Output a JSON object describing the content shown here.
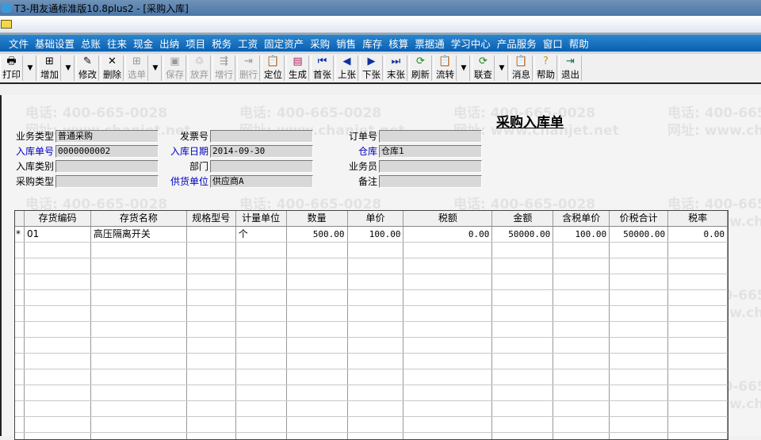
{
  "window": {
    "title": "T3-用友通标准版10.8plus2 - [采购入库]"
  },
  "watermark": {
    "phone": "电话: 400-665-0028",
    "site": "网址: www.chanjet.net"
  },
  "menu": [
    "文件",
    "基础设置",
    "总账",
    "往来",
    "现金",
    "出纳",
    "项目",
    "税务",
    "工资",
    "固定资产",
    "采购",
    "销售",
    "库存",
    "核算",
    "票据通",
    "学习中心",
    "产品服务",
    "窗口",
    "帮助"
  ],
  "toolbar": {
    "print": "打印",
    "add": "增加",
    "edit": "修改",
    "delete": "删除",
    "select": "选单",
    "save": "保存",
    "discard": "放弃",
    "add_row": "增行",
    "del_row": "删行",
    "locate": "定位",
    "generate": "生成",
    "first": "首张",
    "prev": "上张",
    "next": "下张",
    "last": "末张",
    "refresh": "刷新",
    "flow": "流转",
    "query": "联查",
    "message": "消息",
    "help": "帮助",
    "exit": "退出"
  },
  "form": {
    "title": "采购入库单",
    "business_type": {
      "label": "业务类型",
      "value": "普通采购"
    },
    "invoice_no": {
      "label": "发票号",
      "value": ""
    },
    "order_no": {
      "label": "订单号",
      "value": ""
    },
    "receipt_no": {
      "label": "入库单号",
      "value": "0000000002"
    },
    "receipt_date": {
      "label": "入库日期",
      "value": "2014-09-30"
    },
    "warehouse": {
      "label": "仓库",
      "value": "仓库1"
    },
    "receipt_category": {
      "label": "入库类别",
      "value": ""
    },
    "department": {
      "label": "部门",
      "value": ""
    },
    "salesperson": {
      "label": "业务员",
      "value": ""
    },
    "purchase_type": {
      "label": "采购类型",
      "value": ""
    },
    "supplier": {
      "label": "供货单位",
      "value": "供应商A"
    },
    "remark": {
      "label": "备注",
      "value": ""
    }
  },
  "table": {
    "columns": [
      "存货编码",
      "存货名称",
      "规格型号",
      "计量单位",
      "数量",
      "单价",
      "税额",
      "金额",
      "含税单价",
      "价税合计",
      "税率"
    ],
    "rows": [
      {
        "marker": "*",
        "code": "01",
        "name": "高压隔离开关",
        "spec": "",
        "unit": "个",
        "qty": "500.00",
        "price": "100.00",
        "tax": "0.00",
        "amount": "50000.00",
        "tax_price": "100.00",
        "total": "50000.00",
        "tax_rate": "0.00"
      }
    ]
  }
}
